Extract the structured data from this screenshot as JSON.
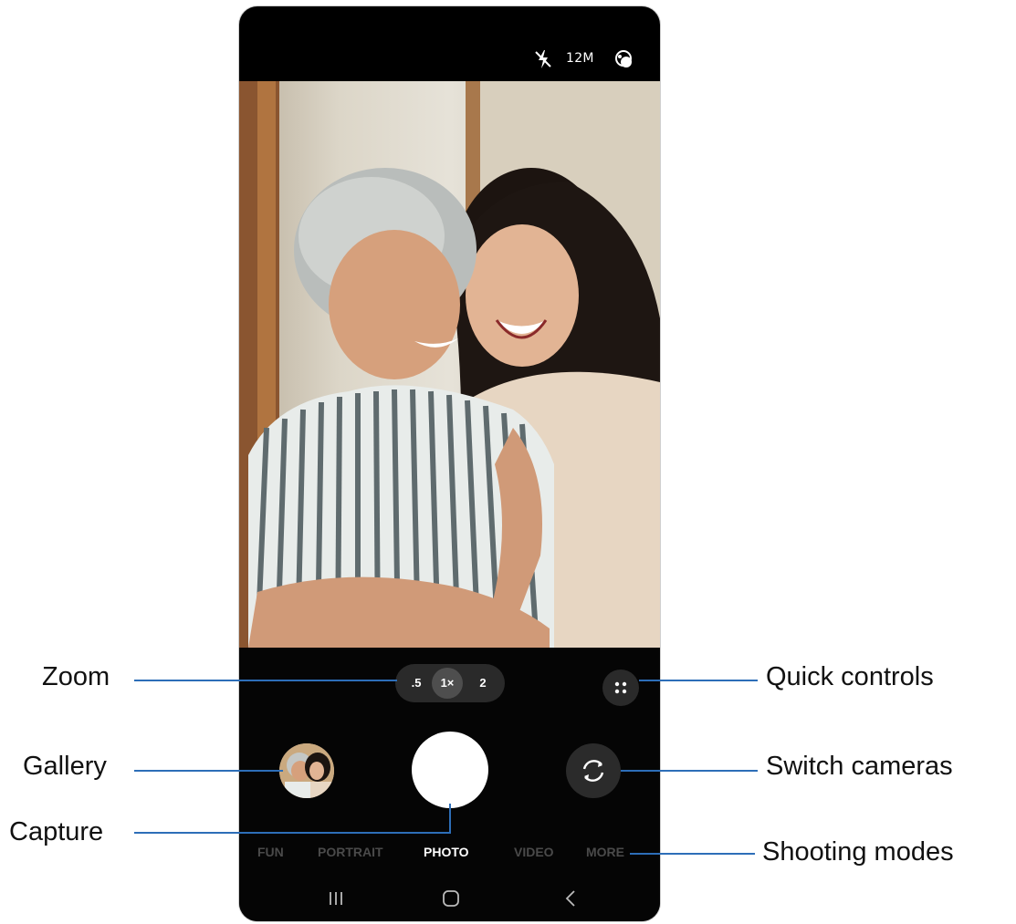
{
  "status_bar": {
    "flash_icon": "flash-off-icon",
    "resolution": "12M",
    "filter_icon": "filter-icon"
  },
  "zoom": {
    "options": [
      ".5",
      "1×",
      "2"
    ],
    "selected": "1×"
  },
  "quick_controls_icon": "grid-dots-icon",
  "switch_camera_icon": "rotate-camera-icon",
  "modes": [
    "FUN",
    "PORTRAIT",
    "PHOTO",
    "VIDEO",
    "MORE"
  ],
  "active_mode": "PHOTO",
  "nav": {
    "recents_icon": "recents-icon",
    "home_icon": "home-icon",
    "back_icon": "back-icon"
  },
  "callouts": {
    "zoom": "Zoom",
    "gallery": "Gallery",
    "capture": "Capture",
    "quick_controls": "Quick controls",
    "switch_cameras": "Switch cameras",
    "shooting_modes": "Shooting modes"
  },
  "colors": {
    "callout_line": "#2d6eb8",
    "phone_bg": "#000000"
  }
}
